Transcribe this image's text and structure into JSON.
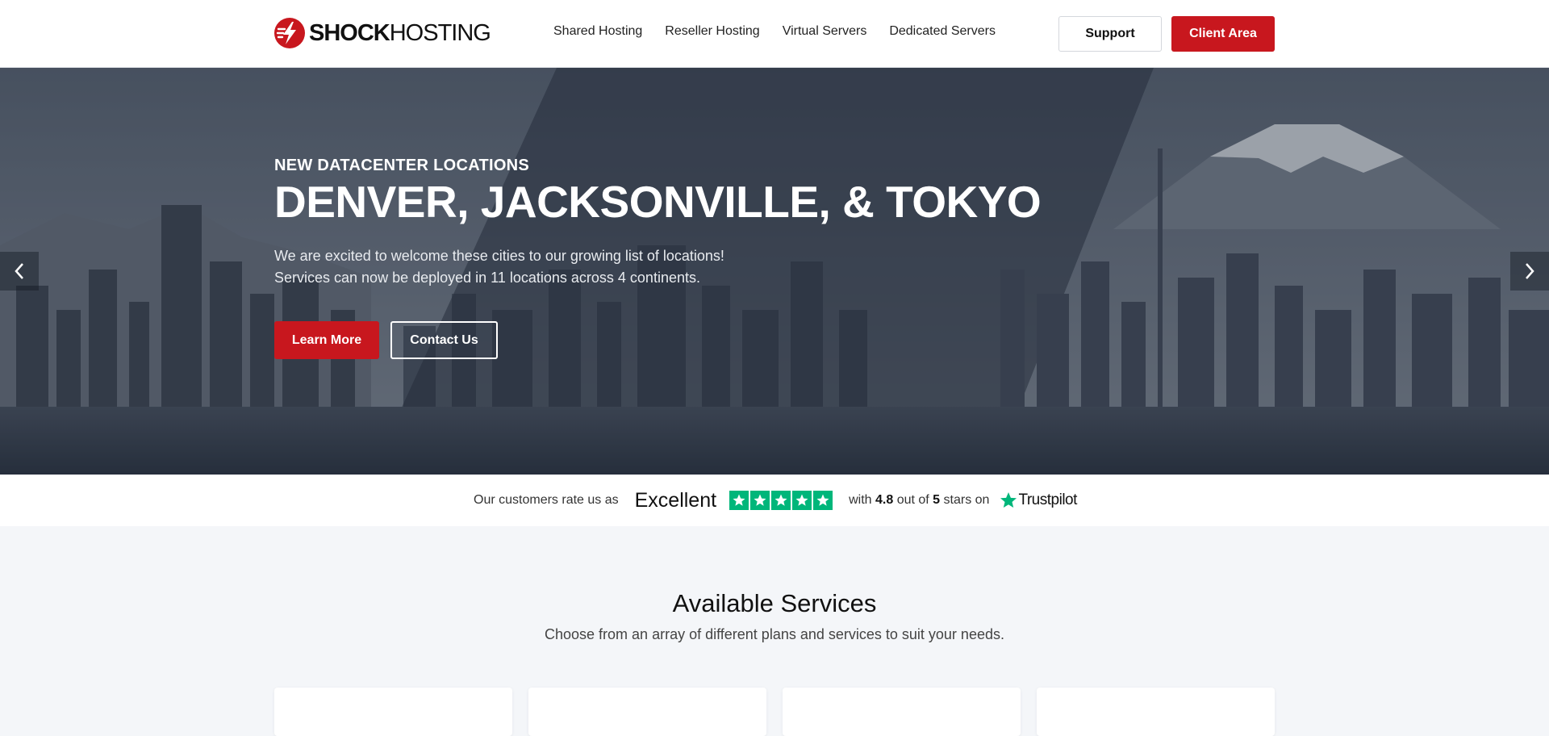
{
  "brand": {
    "name_bold": "SHOCK",
    "name_light": "HOSTING",
    "logo_icon": "lightning-logo-icon",
    "accent_color": "#c8171e"
  },
  "nav": {
    "links": [
      {
        "label": "Shared Hosting"
      },
      {
        "label": "Reseller Hosting"
      },
      {
        "label": "Virtual Servers"
      },
      {
        "label": "Dedicated Servers"
      }
    ],
    "support_label": "Support",
    "client_area_label": "Client Area"
  },
  "hero": {
    "subtitle": "NEW DATACENTER LOCATIONS",
    "title": "DENVER, JACKSONVILLE, & TOKYO",
    "description_line1": "We are excited to welcome these cities to our growing list of locations!",
    "description_line2": "Services can now be deployed in 11 locations across 4 continents.",
    "learn_more_label": "Learn More",
    "contact_label": "Contact Us",
    "prev_icon": "chevron-left-icon",
    "next_icon": "chevron-right-icon"
  },
  "trust": {
    "lead": "Our customers rate us as",
    "rating_word": "Excellent",
    "stars": 5,
    "star_color": "#00b67a",
    "with": "with",
    "score": "4.8",
    "out_of": "out of",
    "max": "5",
    "stars_on": "stars on",
    "platform": "Trustpilot"
  },
  "services": {
    "title": "Available Services",
    "subtitle": "Choose from an array of different plans and services to suit your needs."
  }
}
